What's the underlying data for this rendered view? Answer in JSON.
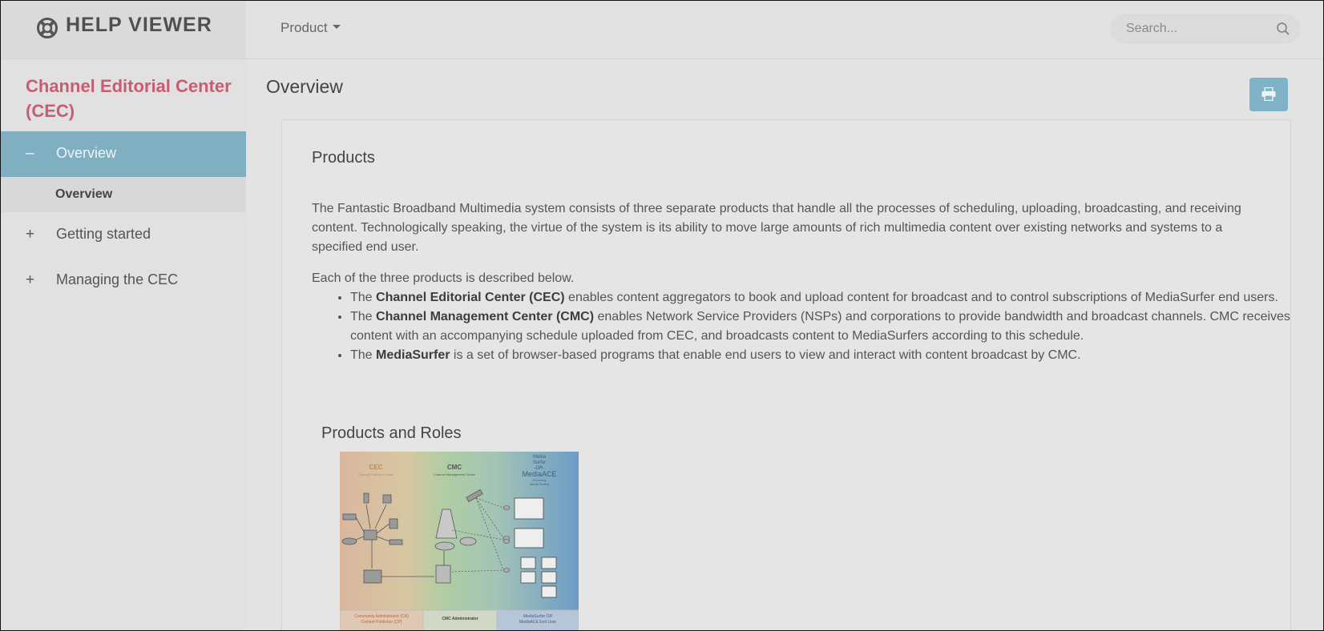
{
  "header": {
    "brand_label": "HELP VIEWER",
    "product_menu_label": "Product",
    "search_placeholder": "Search..."
  },
  "sidebar": {
    "title": "Channel Editorial Center (CEC)",
    "items": [
      {
        "sign": "–",
        "label": "Overview"
      },
      {
        "label": "Overview"
      },
      {
        "sign": "+",
        "label": "Getting started"
      },
      {
        "sign": "+",
        "label": "Managing the CEC"
      }
    ]
  },
  "main": {
    "page_title": "Overview",
    "section_heading": "Products",
    "intro": "The Fantastic Broadband Multimedia system consists of three separate products that handle all the processes of scheduling, uploading, broadcasting, and receiving content. Technologically speaking, the virtue of the system is its ability to move large amounts of rich multimedia content over existing networks and systems to a specified end user.",
    "list_intro": "Each of the three products is described below.",
    "bullets": [
      {
        "pre": "The ",
        "bold": "Channel Editorial Center (CEC)",
        "post": " enables content aggregators to book and upload content for broadcast and to control subscriptions of MediaSurfer end users."
      },
      {
        "pre": "The ",
        "bold": "Channel Management Center (CMC)",
        "post": " enables Network Service Providers (NSPs) and corporations to provide bandwidth and broadcast channels. CMC receives content with an accompanying schedule uploaded from CEC, and broadcasts content to MediaSurfers according to this schedule."
      },
      {
        "pre": "The ",
        "bold": "MediaSurfer",
        "post": " is a set of browser-based programs that enable end users to view and interact with content broadcast by CMC."
      }
    ],
    "figure_caption": "Products and Roles",
    "diagram": {
      "cec_title": "CEC",
      "cec_sub": "Channel Editorial Center",
      "cmc_title": "CMC",
      "cmc_sub": "Channel Management Center",
      "ms_line1": "Media",
      "ms_line2": "Surfer",
      "ms_line3": "-OR-",
      "ms_line4": "MediaACE",
      "ms_line5": "(Formerly",
      "ms_line6": "Media Surfer)",
      "role_ca": "Community Administrator (CA)",
      "role_ca2": "Content Publisher (CP)",
      "role_cmc": "CMC Administrator",
      "role_ms": "MediaSurfer OR",
      "role_ms2": "MediaACE End User"
    }
  },
  "colors": {
    "accent": "#7fafc0",
    "sidebar_title": "#c75d72",
    "print_button": "#80b2c8"
  }
}
